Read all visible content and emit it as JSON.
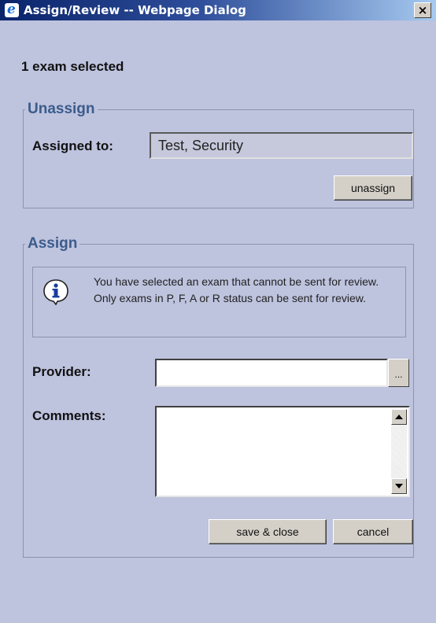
{
  "window": {
    "title": "Assign/Review -- Webpage Dialog",
    "close_glyph": "×",
    "icon": "ie-icon"
  },
  "selection_count": "1 exam selected",
  "unassign": {
    "legend": "Unassign",
    "assigned_to_label": "Assigned to:",
    "assigned_to_value": "Test, Security",
    "button_label": "unassign"
  },
  "assign": {
    "legend": "Assign",
    "info_icon": "info-icon",
    "info_message": "You have selected an exam that cannot be sent for review. Only exams in P, F, A or R status can be sent for review.",
    "provider_label": "Provider:",
    "provider_value": "",
    "provider_browse_label": "...",
    "comments_label": "Comments:",
    "comments_value": "",
    "save_label": "save & close",
    "cancel_label": "cancel"
  },
  "colors": {
    "background": "#bec3de",
    "legend_text": "#3b5c8c",
    "titlebar": "#0a246a"
  }
}
